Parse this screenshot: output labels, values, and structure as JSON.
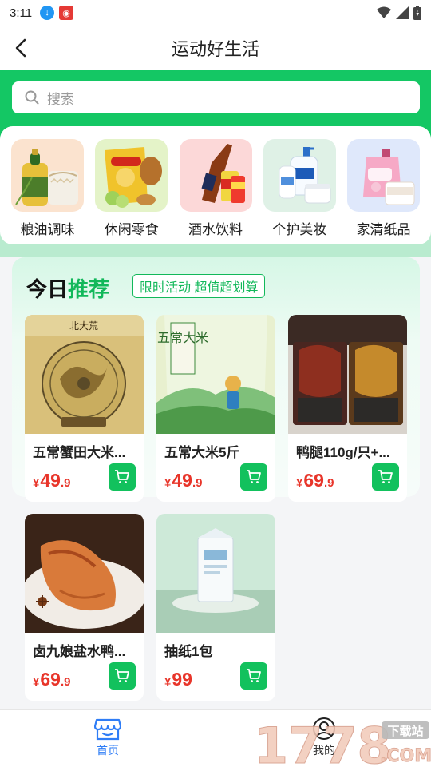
{
  "status_bar": {
    "time": "3:11"
  },
  "header": {
    "title": "运动好生活"
  },
  "search": {
    "placeholder": "搜索"
  },
  "categories": [
    {
      "label": "粮油调味",
      "icon": "cooking-oil-rice"
    },
    {
      "label": "休闲零食",
      "icon": "chips-snacks"
    },
    {
      "label": "酒水饮料",
      "icon": "liquor-drinks"
    },
    {
      "label": "个护美妆",
      "icon": "personal-care"
    },
    {
      "label": "家清纸品",
      "icon": "household-tissue"
    }
  ],
  "recommend": {
    "title_a": "今日",
    "title_b": "推荐",
    "tag": "限时活动 超值超划算"
  },
  "products": [
    {
      "name": "五常蟹田大米...",
      "currency": "¥",
      "price_int": "49",
      "price_dec": ".9"
    },
    {
      "name": "五常大米5斤",
      "currency": "¥",
      "price_int": "49",
      "price_dec": ".9"
    },
    {
      "name": "鸭腿110g/只+...",
      "currency": "¥",
      "price_int": "69",
      "price_dec": ".9"
    },
    {
      "name": "卤九娘盐水鸭...",
      "currency": "¥",
      "price_int": "69",
      "price_dec": ".9"
    },
    {
      "name": "抽纸1包",
      "currency": "¥",
      "price_int": "99",
      "price_dec": ""
    }
  ],
  "product_images": {
    "p1_label": "北大荒",
    "p2_label": "五常大米"
  },
  "bottom_nav": {
    "home": "首页",
    "me": "我的"
  },
  "watermark": {
    "text": "1778",
    "site": "下载站",
    "com": ".COM"
  },
  "colors": {
    "green": "#14c764",
    "accent_green": "#12b85a",
    "price_red": "#e8352a",
    "nav_blue": "#2f7df6"
  }
}
